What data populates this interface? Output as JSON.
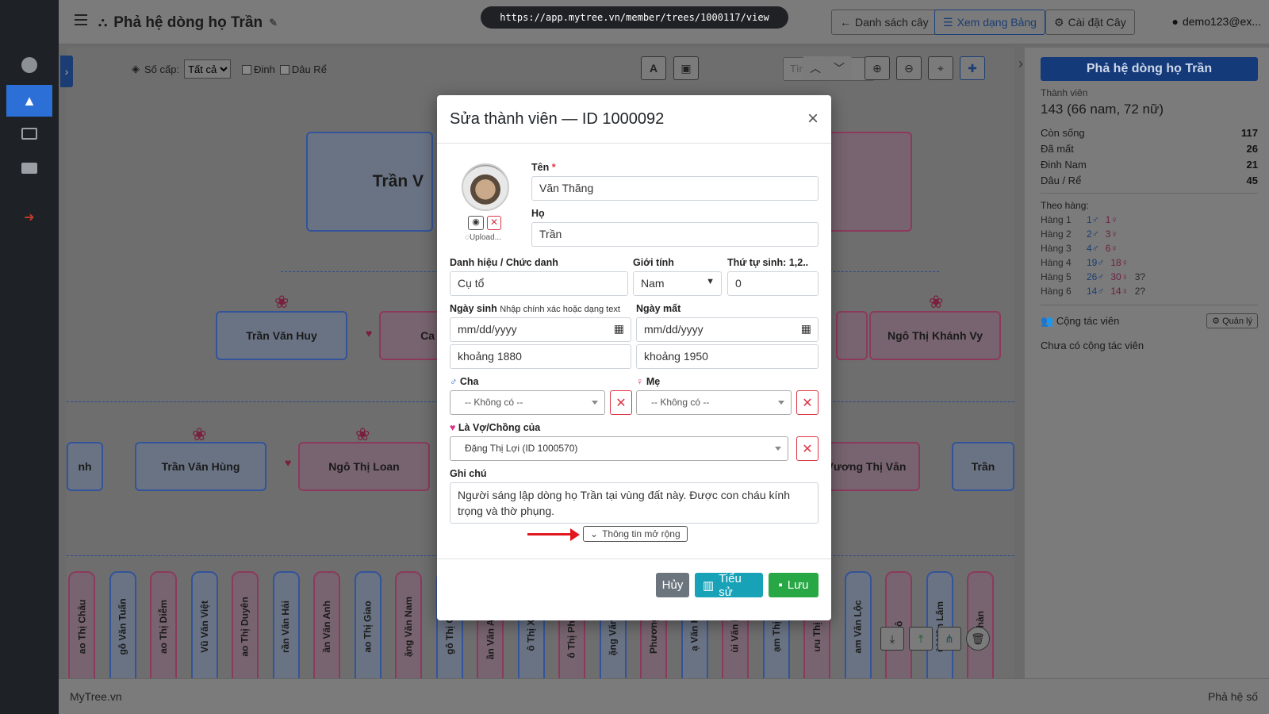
{
  "browser": {
    "url": "https://app.mytree.vn/member/trees/1000117/view"
  },
  "header": {
    "title": "Phả hệ dòng họ Trần",
    "btn_list": "Danh sách cây",
    "btn_table": "Xem dạng Bảng",
    "btn_settings": "Cài đặt Cây",
    "user": "demo123@ex..."
  },
  "toolbar": {
    "levels_label": "Số cấp:",
    "levels_value": "Tất cả",
    "cb_dinh": "Đinh",
    "cb_dau": "Dâu Rể",
    "search_placeholder": "Tìm tên..."
  },
  "tree": {
    "top_left": "Trần V",
    "r1": [
      "Trần Văn Huy",
      "Ca",
      "Ngô Thị Khánh Vy"
    ],
    "r2": [
      "nh",
      "Trần Văn Hùng",
      "Ngô Thị Loan",
      "Vương Thị Vân",
      "Trần"
    ],
    "r3": [
      "ao Thị Châu",
      "gô Văn Tuấn",
      "ao Thị Diễm",
      "Vũ Văn Việt",
      "ao Thị Duyên",
      "rần Văn Hải",
      "ần Văn Anh",
      "ao Thị Giao",
      "ặng Văn Nam",
      "gô Thị Oanh",
      "ần Văn Anh Tu",
      "ô Thị Xuân",
      "ô Thị Phương",
      "ặng Văn Nhậ",
      "Phương Liê",
      "ạ Văn Hoài",
      "ùi Văn Kiên",
      "ạm Thị Yến",
      "ưu Thị Anh",
      "am Văn Lộc",
      "gô",
      "ùi Văn Lâm",
      "y Nhàn"
    ]
  },
  "panel": {
    "title": "Phả hệ dòng họ Trần",
    "members_label": "Thành viên",
    "members_value": "143 (66 nam, 72 nữ)",
    "stats": [
      {
        "label": "Còn sống",
        "value": "117"
      },
      {
        "label": "Đã mất",
        "value": "26"
      },
      {
        "label": "Đinh Nam",
        "value": "21"
      },
      {
        "label": "Dâu / Rể",
        "value": "45"
      }
    ],
    "by_gen_label": "Theo hàng:",
    "gens": [
      {
        "label": "Hàng 1",
        "m": "1♂",
        "w": "1♀",
        "u": ""
      },
      {
        "label": "Hàng 2",
        "m": "2♂",
        "w": "3♀",
        "u": ""
      },
      {
        "label": "Hàng 3",
        "m": "4♂",
        "w": "6♀",
        "u": ""
      },
      {
        "label": "Hàng 4",
        "m": "19♂",
        "w": "18♀",
        "u": ""
      },
      {
        "label": "Hàng 5",
        "m": "26♂",
        "w": "30♀",
        "u": "3?"
      },
      {
        "label": "Hàng 6",
        "m": "14♂",
        "w": "14♀",
        "u": "2?"
      }
    ],
    "collab_label": "Cộng tác viên",
    "manage": "Quản lý",
    "no_collab": "Chưa có cộng tác viên"
  },
  "footer": {
    "left": "MyTree.vn",
    "right": "Phả hệ số"
  },
  "modal": {
    "title": "Sửa thành viên — ID 1000092",
    "close": "×",
    "upload": "Upload...",
    "first_name_label": "Tên",
    "first_name": "Văn Thăng",
    "last_name_label": "Họ",
    "last_name": "Trần",
    "title_label": "Danh hiệu / Chức danh",
    "title_value": "Cụ tổ",
    "gender_label": "Giới tính",
    "gender_value": "Nam",
    "order_label": "Thứ tự sinh: 1,2..",
    "order_value": "0",
    "birth_label": "Ngày sinh",
    "birth_hint": "Nhập chính xác hoặc dạng text",
    "birth_date": "mm/dd/yyyy",
    "birth_text": "khoảng 1880",
    "death_label": "Ngày mất",
    "death_date": "mm/dd/yyyy",
    "death_text": "khoảng 1950",
    "father_label": "Cha",
    "father_value": "-- Không có --",
    "mother_label": "Mẹ",
    "mother_value": "-- Không có --",
    "spouse_label": "Là Vợ/Chồng của",
    "spouse_value": "Đặng Thị Lợi (ID 1000570)",
    "note_label": "Ghi chú",
    "note_value": "Người sáng lập dòng họ Trần tại vùng đất này. Được con cháu kính trọng và thờ phụng.",
    "more": "Thông tin mở rộng",
    "cancel": "Hủy",
    "bio": "Tiểu sử",
    "save": "Lưu"
  }
}
